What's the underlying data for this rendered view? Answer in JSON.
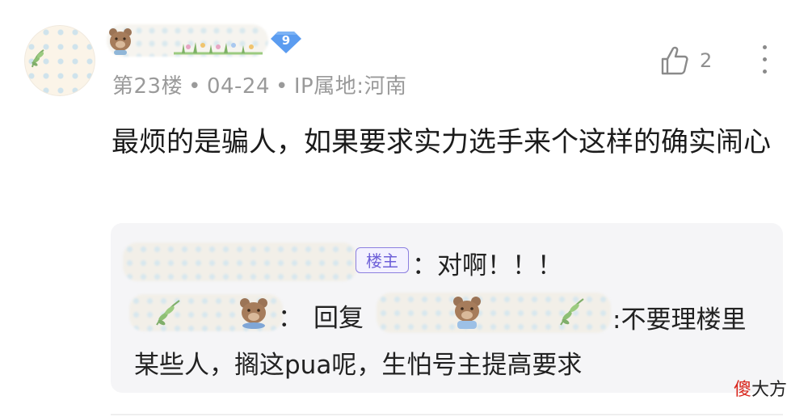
{
  "comment": {
    "floor": "第23楼",
    "date": "04-24",
    "location": "IP属地:河南",
    "separator": "•",
    "level": "9",
    "like_count": "2",
    "text": "最烦的是骗人，如果要求实力选手来个这样的确实闹心"
  },
  "replies": [
    {
      "owner_tag": "楼主",
      "text": "：对啊！！！"
    },
    {
      "colon": "：",
      "reply_prefix": "回复",
      "text": ":不要理楼里某些人，搁这pua呢，生怕号主提高要求"
    }
  ],
  "watermark": {
    "first_char": "傻",
    "rest": "大方"
  },
  "colors": {
    "level_badge": "#5b9cf0",
    "owner_tag": "#6d5fd8",
    "meta_text": "#9a9a9a",
    "watermark_accent": "#d9261c"
  },
  "icons": [
    "thumbs-up-icon",
    "more-vertical-icon",
    "level-diamond-icon",
    "bear-icon",
    "leaf-icon"
  ]
}
